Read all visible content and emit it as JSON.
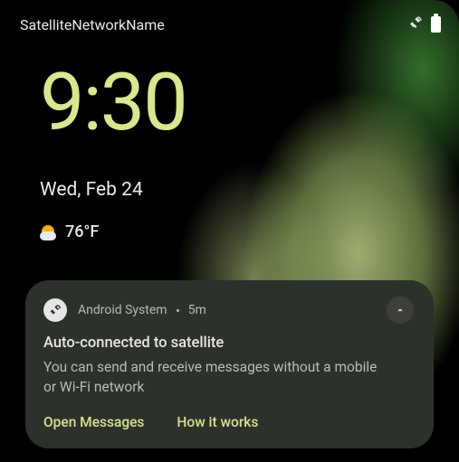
{
  "status_bar": {
    "network_name": "SatelliteNetworkName",
    "satellite_icon": "satellite-icon",
    "battery_icon": "battery-full-icon"
  },
  "clock": {
    "time": "9:30",
    "date": "Wed, Feb 24"
  },
  "weather": {
    "temp": "76°F",
    "condition_icon": "partly-cloudy-icon"
  },
  "notification": {
    "app_icon": "satellite-dish-icon",
    "source": "Android System",
    "age": "5m",
    "title": "Auto-connected to satellite",
    "body": "You can send and receive messages without a mobile or Wi-Fi network",
    "actions": {
      "primary": "Open Messages",
      "secondary": "How it works"
    },
    "expand_icon": "chevron-up-icon"
  },
  "colors": {
    "accent": "#d9e88a",
    "notif_bg": "#2d312c",
    "text_primary": "#e7e9e0",
    "text_secondary": "#b9bcb2"
  }
}
